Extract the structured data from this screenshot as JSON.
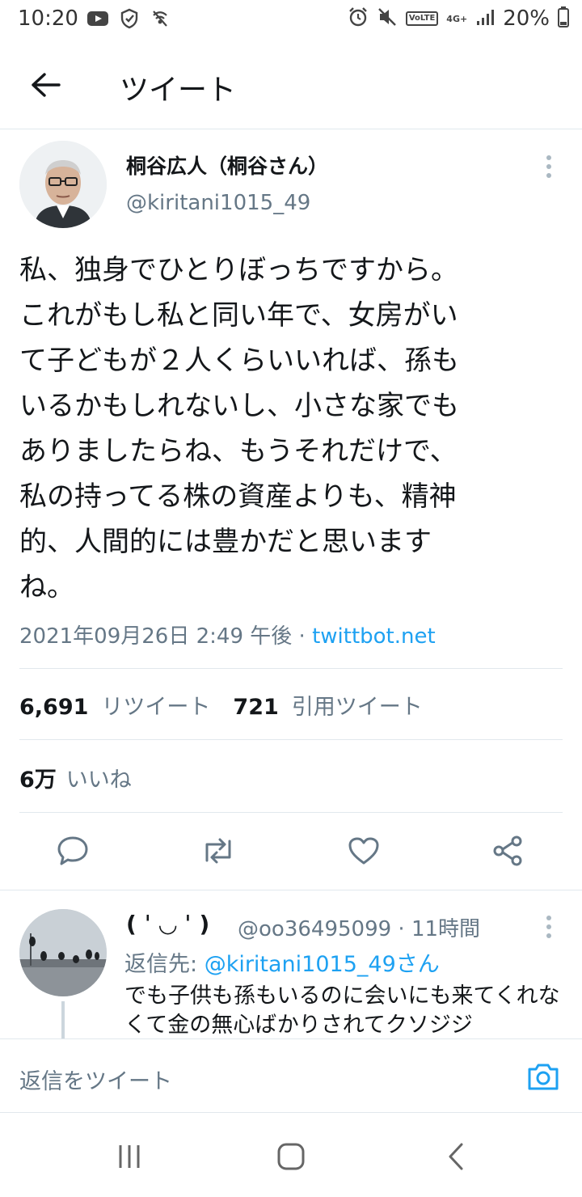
{
  "status_bar": {
    "time": "10:20",
    "battery": "20%",
    "network": "4G+",
    "volte": "VoLTE"
  },
  "app_bar": {
    "title": "ツイート"
  },
  "tweet": {
    "display_name": "桐谷広人（桐谷さん）",
    "handle": "@kiritani1015_49",
    "text": "私、独身でひとりぼっちですから。\nこれがもし私と同い年で、女房がい\nて子どもが２人くらいいれば、孫も\nいるかもしれないし、小さな家でも\nありましたらね、もうそれだけで、\n私の持ってる株の資産よりも、精神\n的、人間的には豊かだと思います\nね。",
    "timestamp": "2021年09月26日 2:49 午後",
    "separator": " · ",
    "source": "twittbot.net",
    "retweets_count": "6,691",
    "retweets_label": "リツイート",
    "quotes_count": "721",
    "quotes_label": "引用ツイート",
    "likes_count": "6万",
    "likes_label": "いいね"
  },
  "reply": {
    "display_name": "( ˈ ◡ ˈ )",
    "handle_time": "@oo36495099 · 11時間",
    "reply_to_prefix": "返信先: ",
    "reply_to_mention": "@kiritani1015_49さん",
    "text": "でも子供も孫もいるのに会いにも来てくれなくて金の無心ばかりされてクソジジ"
  },
  "composer": {
    "placeholder": "返信をツイート"
  },
  "colors": {
    "accent": "#1da1f2",
    "secondary_text": "#657786",
    "divider": "#e1e8ed"
  }
}
